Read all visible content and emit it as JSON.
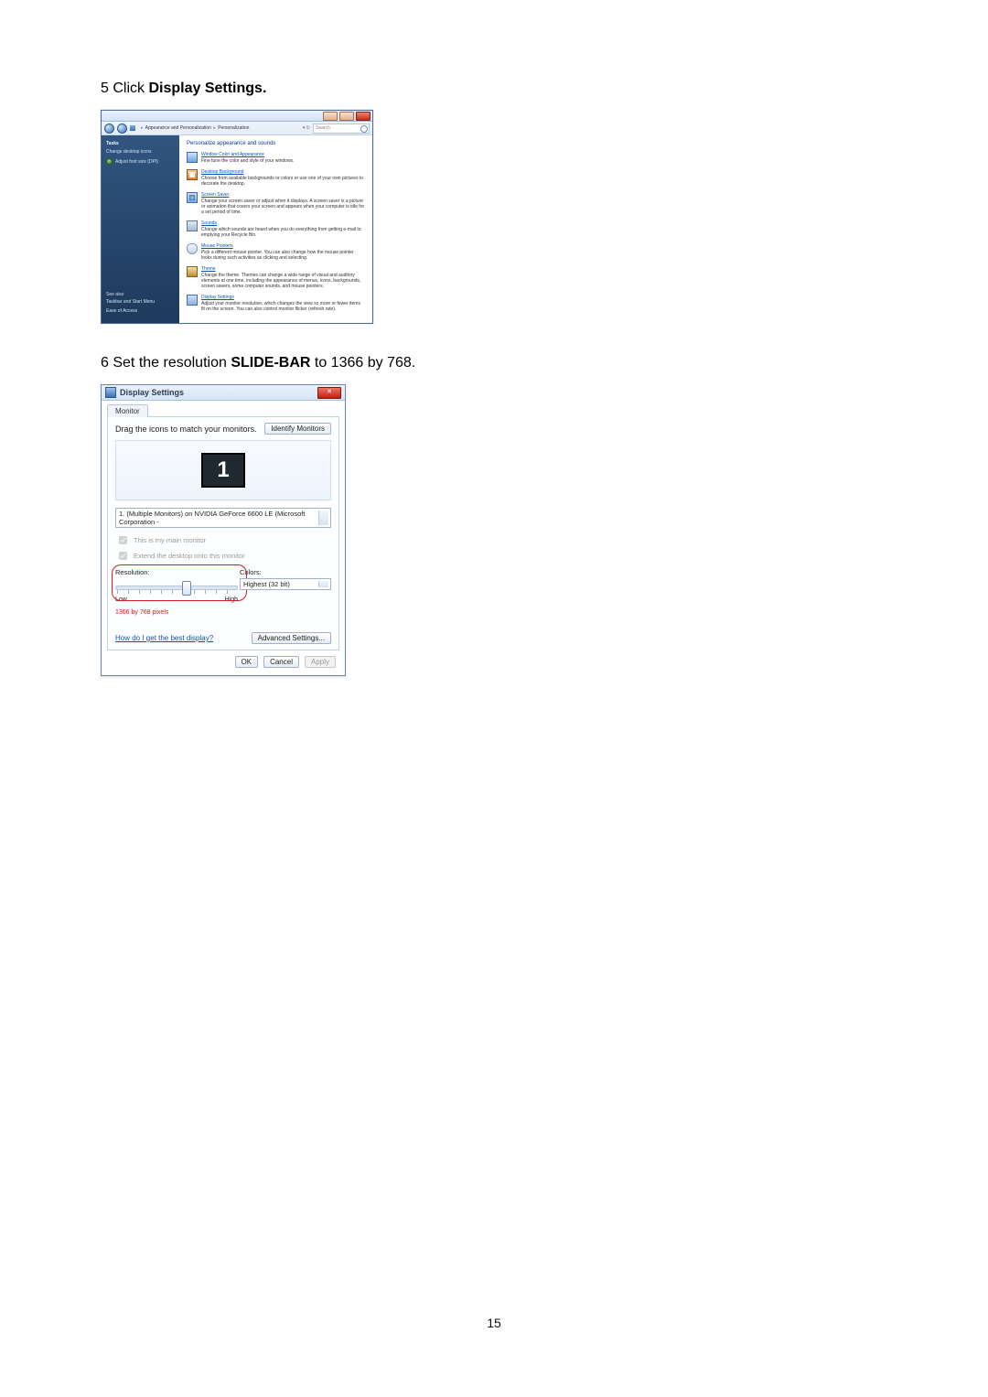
{
  "step5": {
    "num": "5",
    "prefix": " Click ",
    "bold": "Display Settings."
  },
  "step6": {
    "num": "6",
    "prefix": " Set the resolution ",
    "bold": "SLIDE-BAR",
    "suffix": " to 1366 by 768."
  },
  "page_number": "15",
  "control_panel": {
    "breadcrumb": {
      "root": "Appearance and Personalization",
      "current": "Personalization"
    },
    "search_placeholder": "Search",
    "sidebar": {
      "tasks_heading": "Tasks",
      "links": [
        "Change desktop icons",
        "Adjust font size (DPI)"
      ],
      "footer_heading": "See also",
      "footer_links": [
        "Taskbar and Start Menu",
        "Ease of Access"
      ]
    },
    "heading": "Personalize appearance and sounds",
    "items": [
      {
        "title": "Window Color and Appearance",
        "desc": "Fine tune the color and style of your windows."
      },
      {
        "title": "Desktop Background",
        "desc": "Choose from available backgrounds or colors or use one of your own pictures to decorate the desktop."
      },
      {
        "title": "Screen Saver",
        "desc": "Change your screen saver or adjust when it displays. A screen saver is a picture or animation that covers your screen and appears when your computer is idle for a set period of time."
      },
      {
        "title": "Sounds",
        "desc": "Change which sounds are heard when you do everything from getting e-mail to emptying your Recycle Bin."
      },
      {
        "title": "Mouse Pointers",
        "desc": "Pick a different mouse pointer. You can also change how the mouse pointer looks during such activities as clicking and selecting."
      },
      {
        "title": "Theme",
        "desc": "Change the theme. Themes can change a wide range of visual and auditory elements at one time, including the appearance of menus, icons, backgrounds, screen savers, some computer sounds, and mouse pointers."
      },
      {
        "title": "Display Settings",
        "desc": "Adjust your monitor resolution, which changes the view so more or fewer items fit on the screen. You can also control monitor flicker (refresh rate)."
      }
    ]
  },
  "display_settings": {
    "title": "Display Settings",
    "tab": "Monitor",
    "drag_label": "Drag the icons to match your monitors.",
    "identify_btn": "Identify Monitors",
    "monitor_number": "1",
    "monitor_select": "1. (Multiple Monitors) on NVIDIA GeForce 6600 LE (Microsoft Corporation -",
    "chk_main": "This is my main monitor",
    "chk_extend": "Extend the desktop onto this monitor",
    "resolution_label": "Resolution:",
    "slider_low": "Low",
    "slider_high": "High",
    "resolution_value": "1366 by 768 pixels",
    "colors_label": "Colors:",
    "colors_value": "Highest (32 bit)",
    "help_link": "How do I get the best display?",
    "advanced_btn": "Advanced Settings...",
    "ok_btn": "OK",
    "cancel_btn": "Cancel",
    "apply_btn": "Apply"
  }
}
